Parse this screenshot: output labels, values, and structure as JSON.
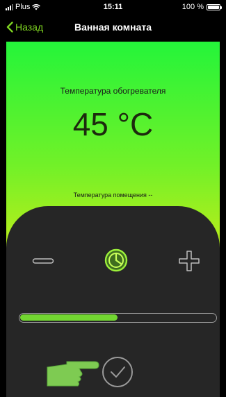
{
  "status_bar": {
    "carrier": "Plus",
    "time": "15:11",
    "battery": "100 %"
  },
  "nav": {
    "back_label": "Назад",
    "title": "Ванная комната"
  },
  "heater": {
    "label": "Температура обогревателя",
    "temperature": "45 °C",
    "room_label": "Температура помещения --"
  },
  "controls": {
    "slider_level": 0.5
  },
  "colors": {
    "accent": "#7ed321",
    "gradient_top": "#24f43a",
    "gradient_bottom": "#e6e612",
    "panel": "#262626",
    "slider_fill": "#72d631"
  },
  "icons": [
    "signal-icon",
    "wifi-icon",
    "battery-icon",
    "back-chevron-icon",
    "minus-icon",
    "power-icon",
    "plus-icon",
    "hand-pointer-icon",
    "checkmark-icon"
  ]
}
